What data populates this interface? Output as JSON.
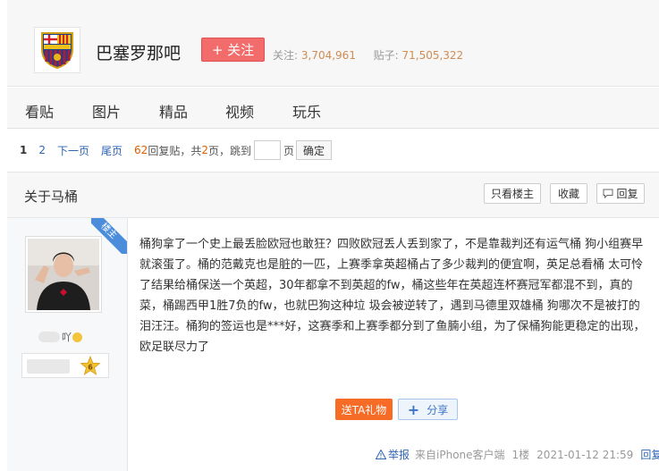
{
  "forum": {
    "name": "巴塞罗那吧",
    "follow_label": "+ 关注",
    "followers_label": "关注:",
    "followers": "3,704,961",
    "posts_label": "贴子:",
    "posts": "71,505,322"
  },
  "nav": {
    "items": [
      {
        "label": "看贴"
      },
      {
        "label": "图片"
      },
      {
        "label": "精品"
      },
      {
        "label": "视频"
      },
      {
        "label": "玩乐"
      }
    ]
  },
  "pager": {
    "current": "1",
    "page2": "2",
    "next": "下一页",
    "last": "尾页",
    "reply_count": "62",
    "reply_text": "回复贴，共",
    "total_pages": "2",
    "page_suffix": "页，跳到",
    "page_unit": "页",
    "confirm": "确定"
  },
  "thread": {
    "title": "关于马桶",
    "only_op": "只看楼主",
    "favorite": "收藏",
    "reply": "回复"
  },
  "post": {
    "badge": "楼主",
    "username_visible": "吖",
    "content": "桶狗拿了一个史上最丢脸欧冠也敢狂？四败欧冠丢人丢到家了，不是靠裁判还有运气桶 狗小组赛早就滚蛋了。桶的范戴克也是脏的一匹，上赛季拿英超桶占了多少裁判的便宜啊，英足总看桶 太可怜了结果给桶保送一个英超，30年都拿不到英超的fw，桶这些年在英超连杯赛冠军都混不到，真的菜，桶踢西甲1胜7负的fw，也就巴狗这种垃 圾会被逆转了，遇到马德里双雄桶 狗哪次不是被打的泪汪汪。桶狗的签运也是***好，这赛季和上赛季都分到了鱼腩小组，为了保桶狗能更稳定的出现，欧足联尽力了",
    "level": "6",
    "gift": "送TA礼物",
    "share": "分享",
    "report": "举报",
    "source": "来自iPhone客户端",
    "floor": "1楼",
    "time": "2021-01-12 21:59",
    "reply": "回复"
  },
  "colors": {
    "accent_red": "#f26c6c",
    "link_blue": "#2d64b3",
    "orange": "#f66b25",
    "stat_orange": "#d08b52"
  }
}
